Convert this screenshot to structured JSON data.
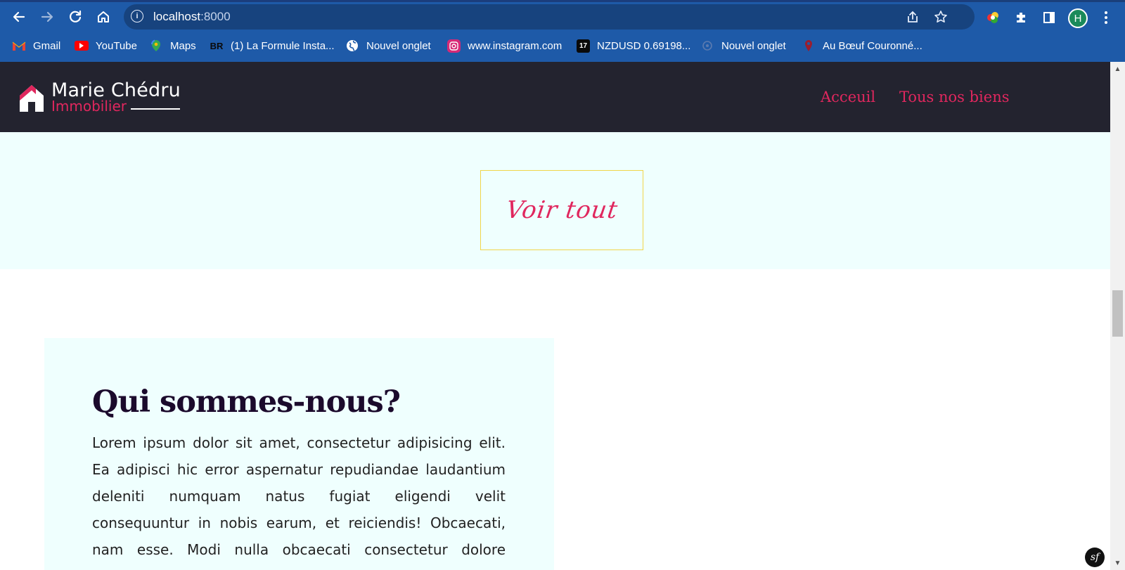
{
  "browser": {
    "url_host": "localhost",
    "url_port": ":8000",
    "profile_initial": "H",
    "bookmarks": [
      {
        "label": "Gmail",
        "icon": "gmail-icon"
      },
      {
        "label": "YouTube",
        "icon": "youtube-icon"
      },
      {
        "label": "Maps",
        "icon": "maps-icon"
      },
      {
        "label": "(1) La Formule Insta...",
        "icon": "br-icon",
        "icon_text": "BR"
      },
      {
        "label": "Nouvel onglet",
        "icon": "globe-icon"
      },
      {
        "label": "www.instagram.com",
        "icon": "instagram-icon"
      },
      {
        "label": "NZDUSD 0.69198...",
        "icon": "tradingview-icon",
        "icon_text": "17"
      },
      {
        "label": "Nouvel onglet",
        "icon": "tab-icon"
      },
      {
        "label": "Au Bœuf Couronné...",
        "icon": "pin-icon"
      }
    ]
  },
  "site": {
    "brand_name": "Marie Chédru",
    "brand_sub": "Immobilier",
    "nav": [
      "Acceuil",
      "Tous nos biens"
    ],
    "voir_tout": "Voir tout",
    "about_title": "Qui sommes-nous?",
    "about_text": "Lorem ipsum dolor sit amet, consectetur adipisicing elit. Ea adipisci hic error aspernatur repudiandae laudantium deleniti numquam natus fugiat eligendi velit consequuntur in nobis earum, et reiciendis! Obcaecati, nam esse. Modi nulla obcaecati consectetur dolore numquam atque saepe",
    "badge": "sf"
  },
  "colors": {
    "chrome": "#1e5aa8",
    "header": "#23232f",
    "accent": "#e0275e",
    "section_bg": "#effffe",
    "button_border": "#f1d54a",
    "title": "#1b0a2c"
  }
}
